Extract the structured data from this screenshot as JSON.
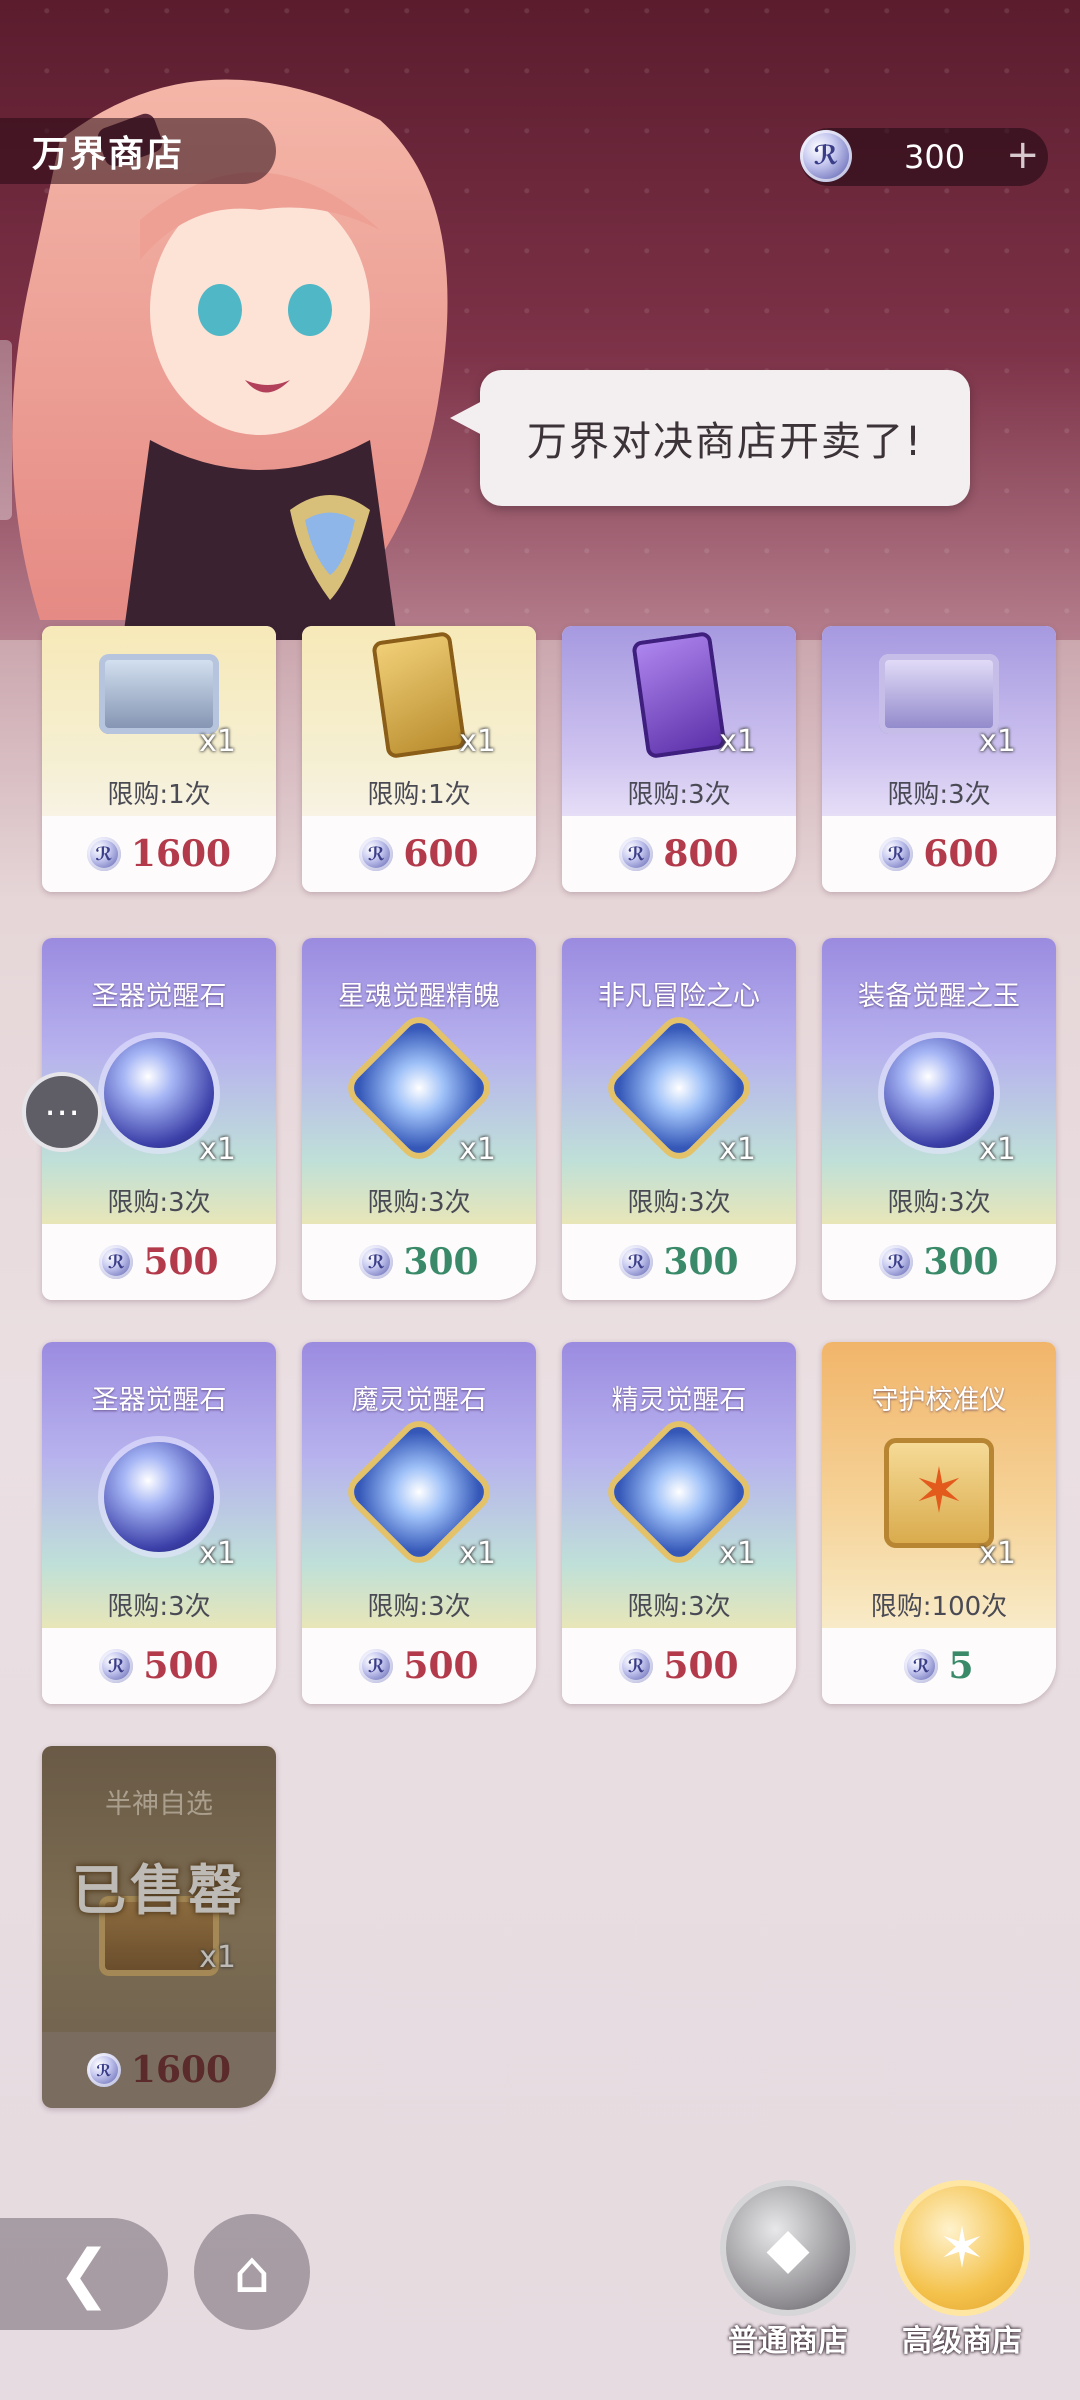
{
  "header": {
    "title": "万界商店",
    "currency_value": "300",
    "currency_add": "+",
    "speech": "万界对决商店开卖了!"
  },
  "items": [
    {
      "qty": "x1",
      "limit": "限购:1次",
      "price": "1600",
      "price_color": "red"
    },
    {
      "qty": "x1",
      "limit": "限购:1次",
      "price": "600",
      "price_color": "red"
    },
    {
      "qty": "x1",
      "limit": "限购:3次",
      "price": "800",
      "price_color": "red"
    },
    {
      "qty": "x1",
      "limit": "限购:3次",
      "price": "600",
      "price_color": "red"
    },
    {
      "name": "圣器觉醒石",
      "qty": "x1",
      "limit": "限购:3次",
      "price": "500",
      "price_color": "red"
    },
    {
      "name": "星魂觉醒精魄",
      "qty": "x1",
      "limit": "限购:3次",
      "price": "300",
      "price_color": "green"
    },
    {
      "name": "非凡冒险之心",
      "qty": "x1",
      "limit": "限购:3次",
      "price": "300",
      "price_color": "green"
    },
    {
      "name": "装备觉醒之玉",
      "qty": "x1",
      "limit": "限购:3次",
      "price": "300",
      "price_color": "green"
    },
    {
      "name": "圣器觉醒石",
      "qty": "x1",
      "limit": "限购:3次",
      "price": "500",
      "price_color": "red"
    },
    {
      "name": "魔灵觉醒石",
      "qty": "x1",
      "limit": "限购:3次",
      "price": "500",
      "price_color": "red"
    },
    {
      "name": "精灵觉醒石",
      "qty": "x1",
      "limit": "限购:3次",
      "price": "500",
      "price_color": "red"
    },
    {
      "name": "守护校准仪",
      "qty": "x1",
      "limit": "限购:100次",
      "price": "5",
      "price_color": "green"
    }
  ],
  "sold_item": {
    "name": "半神自选",
    "status": "已售罄",
    "qty": "x1",
    "price": "1600"
  },
  "nav": {
    "normal_shop": "普通商店",
    "premium_shop": "高级商店"
  },
  "colors": {
    "price_red": "#b23a4a",
    "price_green": "#3a8a6a"
  }
}
